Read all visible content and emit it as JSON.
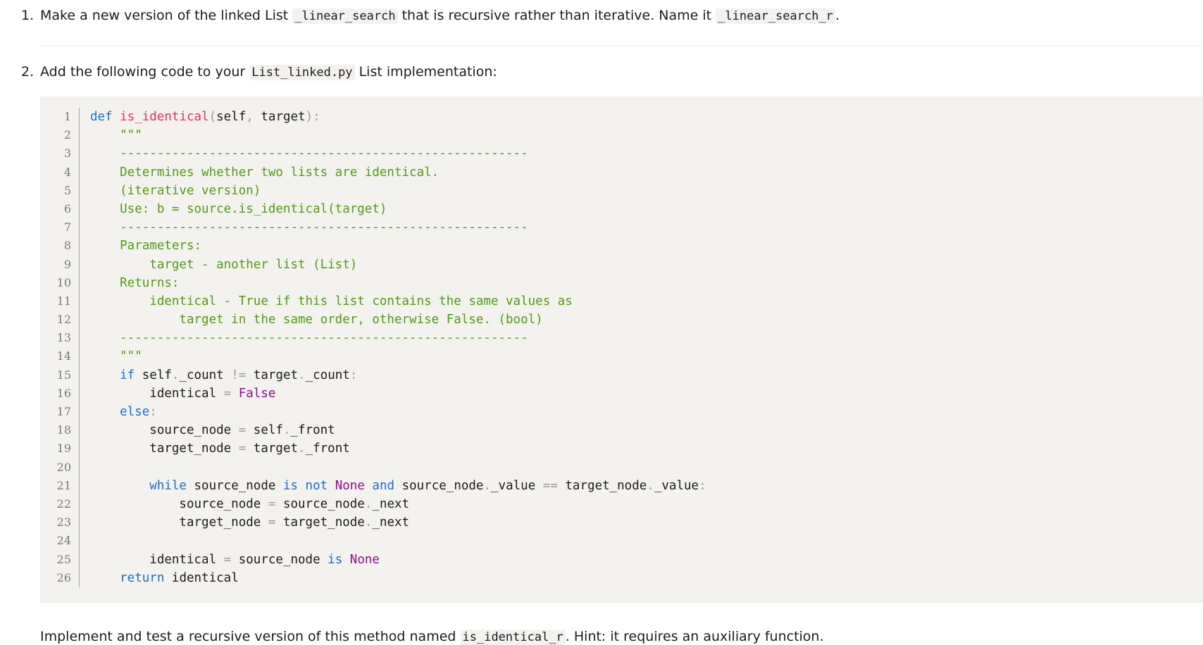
{
  "task1": {
    "number": "1.",
    "text_a": "Make a new version of the linked List ",
    "code_a": "_linear_search",
    "text_b": " that is recursive rather than iterative. Name it ",
    "code_b": "_linear_search_r",
    "text_c": "."
  },
  "task2": {
    "number": "2.",
    "text_a": "Add the following code to your ",
    "code_a": "List_linked.py",
    "text_b": " List implementation:"
  },
  "code": {
    "line_numbers": [
      "1",
      "2",
      "3",
      "4",
      "5",
      "6",
      "7",
      "8",
      "9",
      "10",
      "11",
      "12",
      "13",
      "14",
      "15",
      "16",
      "17",
      "18",
      "19",
      "20",
      "21",
      "22",
      "23",
      "24",
      "25",
      "26"
    ],
    "lines": [
      [
        [
          "kw",
          "def "
        ],
        [
          "fn",
          "is_identical"
        ],
        [
          "op",
          "("
        ],
        [
          "",
          "self"
        ],
        [
          "op",
          ", "
        ],
        [
          "",
          "target"
        ],
        [
          "op",
          "):"
        ]
      ],
      [
        [
          "cm",
          "    \"\"\""
        ]
      ],
      [
        [
          "cm",
          "    -------------------------------------------------------"
        ]
      ],
      [
        [
          "cm",
          "    Determines whether two lists are identical."
        ]
      ],
      [
        [
          "cm",
          "    (iterative version)"
        ]
      ],
      [
        [
          "cm",
          "    Use: b = source.is_identical(target)"
        ]
      ],
      [
        [
          "cm",
          "    -------------------------------------------------------"
        ]
      ],
      [
        [
          "cm",
          "    Parameters:"
        ]
      ],
      [
        [
          "cm",
          "        target - another list (List)"
        ]
      ],
      [
        [
          "cm",
          "    Returns:"
        ]
      ],
      [
        [
          "cm",
          "        identical - True if this list contains the same values as"
        ]
      ],
      [
        [
          "cm",
          "            target in the same order, otherwise False. (bool)"
        ]
      ],
      [
        [
          "cm",
          "    -------------------------------------------------------"
        ]
      ],
      [
        [
          "cm",
          "    \"\"\""
        ]
      ],
      [
        [
          "kw",
          "    if "
        ],
        [
          "",
          "self"
        ],
        [
          "op",
          "."
        ],
        [
          "",
          "_count "
        ],
        [
          "op",
          "!= "
        ],
        [
          "",
          "target"
        ],
        [
          "op",
          "."
        ],
        [
          "",
          "_count"
        ],
        [
          "op",
          ":"
        ]
      ],
      [
        [
          "",
          "        identical "
        ],
        [
          "op",
          "= "
        ],
        [
          "lit",
          "False"
        ]
      ],
      [
        [
          "kw",
          "    else"
        ],
        [
          "op",
          ":"
        ]
      ],
      [
        [
          "",
          "        source_node "
        ],
        [
          "op",
          "= "
        ],
        [
          "",
          "self"
        ],
        [
          "op",
          "."
        ],
        [
          "",
          "_front"
        ]
      ],
      [
        [
          "",
          "        target_node "
        ],
        [
          "op",
          "= "
        ],
        [
          "",
          "target"
        ],
        [
          "op",
          "."
        ],
        [
          "",
          "_front"
        ]
      ],
      [
        [
          "",
          ""
        ]
      ],
      [
        [
          "kw",
          "        while "
        ],
        [
          "",
          "source_node "
        ],
        [
          "kw",
          "is not "
        ],
        [
          "lit",
          "None "
        ],
        [
          "kw",
          "and "
        ],
        [
          "",
          "source_node"
        ],
        [
          "op",
          "."
        ],
        [
          "",
          "_value "
        ],
        [
          "op",
          "== "
        ],
        [
          "",
          "target_node"
        ],
        [
          "op",
          "."
        ],
        [
          "",
          "_value"
        ],
        [
          "op",
          ":"
        ]
      ],
      [
        [
          "",
          "            source_node "
        ],
        [
          "op",
          "= "
        ],
        [
          "",
          "source_node"
        ],
        [
          "op",
          "."
        ],
        [
          "",
          "_next"
        ]
      ],
      [
        [
          "",
          "            target_node "
        ],
        [
          "op",
          "= "
        ],
        [
          "",
          "target_node"
        ],
        [
          "op",
          "."
        ],
        [
          "",
          "_next"
        ]
      ],
      [
        [
          "",
          ""
        ]
      ],
      [
        [
          "",
          "        identical "
        ],
        [
          "op",
          "= "
        ],
        [
          "",
          "source_node "
        ],
        [
          "kw",
          "is "
        ],
        [
          "lit",
          "None"
        ]
      ],
      [
        [
          "kw",
          "    return "
        ],
        [
          "",
          "identical"
        ]
      ]
    ]
  },
  "footer": {
    "text_a": "Implement and test a recursive version of this method named ",
    "code_a": "is_identical_r",
    "text_b": ". Hint: it requires an auxiliary function."
  }
}
